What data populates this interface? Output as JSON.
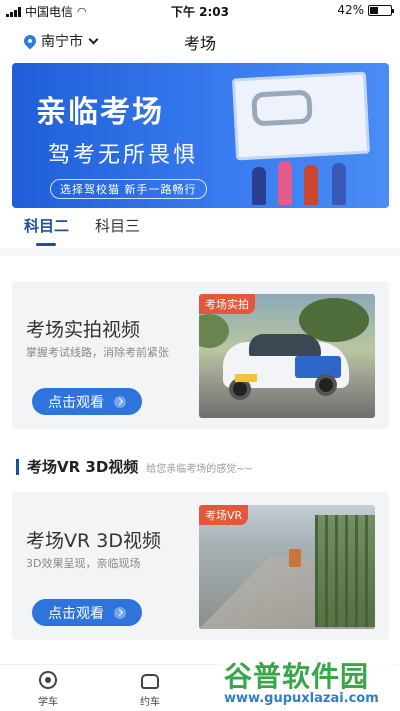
{
  "status": {
    "carrier": "中国电信",
    "time": "下午 2:03",
    "battery": "42%",
    "battery_level": 0.42
  },
  "header": {
    "city": "南宁市",
    "title": "考场"
  },
  "banner": {
    "title": "亲临考场",
    "subtitle": "驾考无所畏惧",
    "tagline": "选择驾校猫 新手一路畅行"
  },
  "tabs": [
    {
      "label": "科目二",
      "active": true
    },
    {
      "label": "科目三",
      "active": false
    }
  ],
  "cards": [
    {
      "title": "考场实拍视频",
      "subtitle": "掌握考试线路，消除考前紧张",
      "button": "点击观看",
      "tag": "考场实拍",
      "plate": "桂A 2J1学"
    },
    {
      "title": "考场VR 3D视频",
      "subtitle": "3D效果呈现，亲临现场",
      "button": "点击观看",
      "tag": "考场VR"
    }
  ],
  "section": {
    "title": "考场VR 3D视频",
    "subtitle": "给您亲临考场的感觉~~"
  },
  "tab_bar": {
    "items": [
      {
        "label": "学车",
        "icon": "steering-wheel-icon"
      },
      {
        "label": "约车",
        "icon": "car-icon"
      }
    ]
  },
  "watermark": {
    "brand": "谷普软件园",
    "url": "www.gupuxlazai.com"
  },
  "colors": {
    "accent": "#1d4fa3",
    "button": "#2f74dd",
    "tag": "#e4573b",
    "banner": "#2f6fe6"
  }
}
